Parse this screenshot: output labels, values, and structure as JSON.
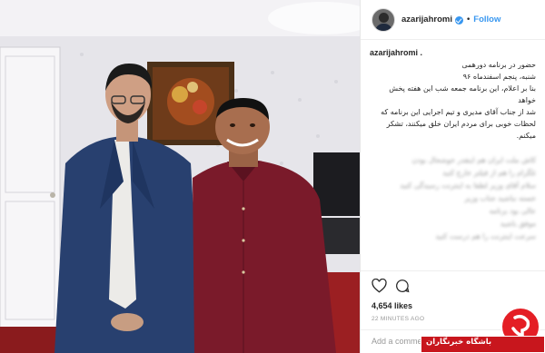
{
  "post": {
    "username": "azarijahromi",
    "follow_dot": "•",
    "follow_label": "Follow",
    "caption_username": "azarijahromi .",
    "caption_lines": [
      "حضور در برنامه دورهمی",
      "شنبه، پنجم اسفندماه ۹۶",
      "بنا بر اعلام، این برنامه جمعه شب این هفته پخش خواهد",
      "شد از جناب آقای مدیری و تیم اجرایی این برنامه که",
      "لحظات خوبی برای مردم ایران خلق میکنند، تشکر میکنم."
    ],
    "blurred_comments": [
      "کاش ملت ایران هم اینقدر خوشحال بودن",
      "تلگرام را هم از فیلتر خارج کنید",
      "سلام آقای وزیر لطفا به اینترنت رسیدگی کنید",
      "خسته نباشید جناب وزیر",
      "عالی بود برنامه",
      "موفق باشید",
      "سرعت اینترنت را هم درست کنید"
    ],
    "likes": "4,654 likes",
    "timestamp": "22 MINUTES AGO",
    "comment_placeholder": "Add a comment..."
  },
  "watermark": {
    "text": "باشگاه خبرنگاران",
    "color": "#e41e25"
  },
  "icons": {
    "heart": "heart-icon",
    "comment": "comment-icon",
    "verified": "verified-badge-icon"
  }
}
